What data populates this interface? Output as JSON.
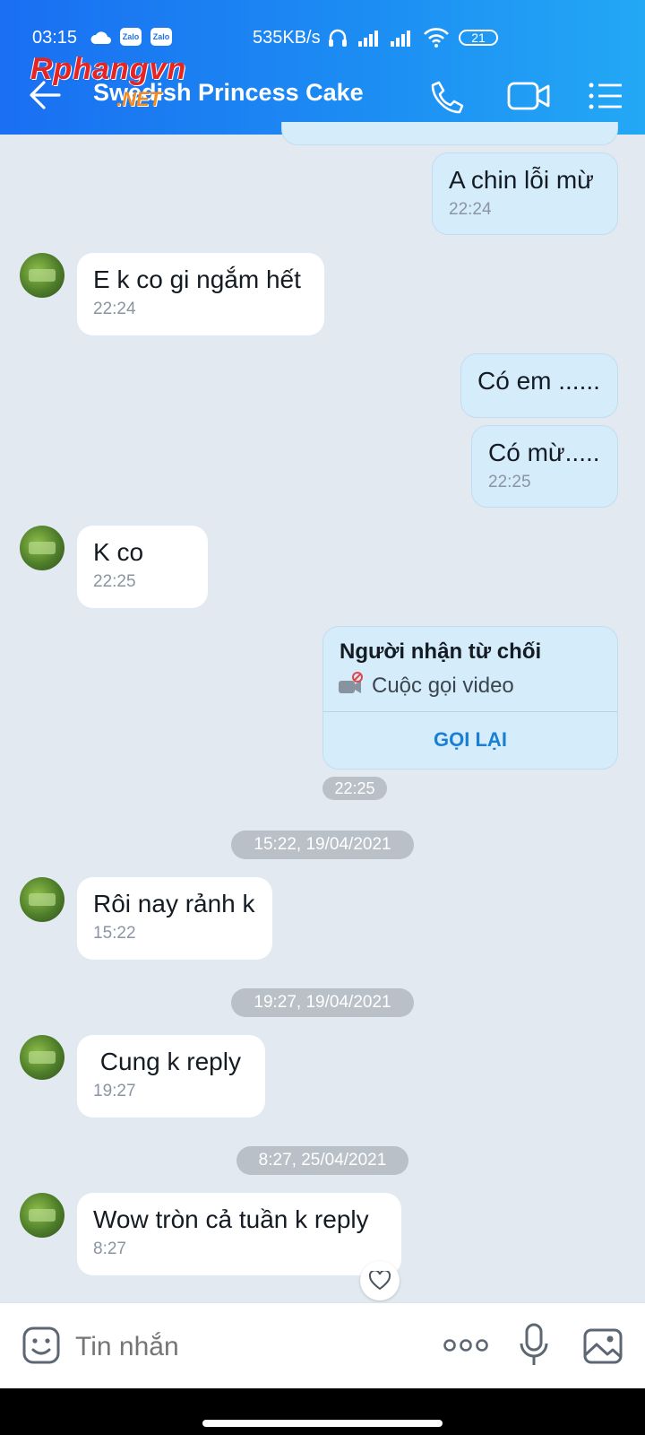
{
  "status_bar": {
    "time": "03:15",
    "zalo_badge": "Zalo",
    "net_speed": "535KB/s",
    "battery": "21"
  },
  "header": {
    "title": "Swedish Princess Cake",
    "watermark_main": "Rphangvn",
    "watermark_sub": ".NET"
  },
  "messages": {
    "m1": {
      "text": "A chin lỗi mừ",
      "time": "22:24"
    },
    "m2": {
      "text": "E k co gi ngắm hết",
      "time": "22:24"
    },
    "m3": {
      "text": "Có em ......"
    },
    "m4": {
      "text": "Có mừ.....",
      "time": "22:25"
    },
    "m5": {
      "text": "K co",
      "time": "22:25"
    },
    "call": {
      "title": "Người nhận từ chối",
      "subtitle": "Cuộc gọi video",
      "action": "GỌI LẠI",
      "time": "22:25"
    },
    "d1": "15:22, 19/04/2021",
    "m6": {
      "text": "Rôi nay rảnh k",
      "time": "15:22"
    },
    "d2": "19:27, 19/04/2021",
    "m7": {
      "text": " Cung k reply",
      "time": "19:27"
    },
    "d3": "8:27, 25/04/2021",
    "m8": {
      "text": "Wow tròn cả tuần k reply",
      "time": "8:27"
    }
  },
  "composer": {
    "placeholder": "Tin nhắn"
  },
  "colors": {
    "header_gradient_start": "#1a6ff2",
    "header_gradient_end": "#23a8f5",
    "chat_background": "#e2e9f1",
    "outgoing_bubble": "#d5ecfb",
    "incoming_bubble": "#ffffff",
    "link_blue": "#1a7fd4"
  },
  "icons": [
    "back-arrow-icon",
    "phone-icon",
    "video-camera-icon",
    "list-menu-icon",
    "heart-icon",
    "sticker-icon",
    "more-dots-icon",
    "microphone-icon",
    "gallery-icon",
    "missed-video-icon"
  ]
}
